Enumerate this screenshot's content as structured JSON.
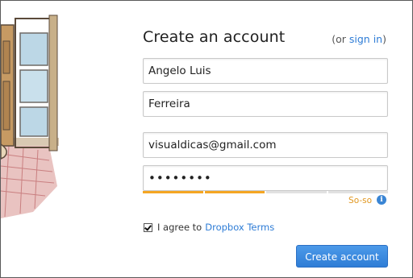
{
  "form": {
    "title": "Create an account",
    "signin_prefix": "(or ",
    "signin_link": "sign in",
    "signin_suffix": ")",
    "first_name_value": "Angelo Luis",
    "last_name_value": "Ferreira",
    "email_value": "visualdicas@gmail.com",
    "password_value": "••••••••",
    "strength_label": "So-so",
    "strength_segments_filled": 2,
    "strength_segments_total": 4,
    "agree_checked": true,
    "agree_text": "I agree to",
    "agree_link": "Dropbox Terms",
    "submit_label": "Create account"
  },
  "colors": {
    "accent": "#2e7cd6",
    "strength": "#f5a623",
    "button": "#3a86da"
  },
  "icons": {
    "info": "i"
  }
}
